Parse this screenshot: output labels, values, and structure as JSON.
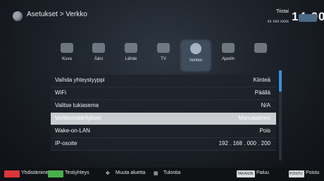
{
  "header": {
    "breadcrumb": "Asetukset > Verkko",
    "day": "Tiistai",
    "date": "xx xxx xxxx",
    "time": "14:00"
  },
  "tabs": [
    {
      "label": "Kuva",
      "icon": "picture-icon"
    },
    {
      "label": "Ääni",
      "icon": "sound-icon"
    },
    {
      "label": "Lähde",
      "icon": "source-icon"
    },
    {
      "label": "TV",
      "icon": "tv-icon"
    },
    {
      "label": "Verkko",
      "icon": "network-icon",
      "active": true
    },
    {
      "label": "Ajastin",
      "icon": "timer-icon"
    },
    {
      "label": "",
      "icon": "settings-icon"
    }
  ],
  "settings": [
    {
      "key": "Vaihda yhteystyyppi",
      "value": "Kiinteä"
    },
    {
      "key": "WiFi",
      "value": "Päällä"
    },
    {
      "key": "Valitse tukiasema",
      "value": "N/A"
    },
    {
      "key": "Verkkomääritykset",
      "value": "Manuaalinen",
      "selected": true
    },
    {
      "key": "Wake-on-LAN",
      "value": "Pois"
    },
    {
      "key": "IP-osoite",
      "value": "192 . 168 . 000 . 200"
    }
  ],
  "footer": {
    "connect": "Yhdistäminen",
    "test": "Testiyhteys",
    "move": "Muuta aluetta",
    "print": "Tulostia",
    "back_key": "TAKAISIN",
    "back": "Paluu",
    "exit_key": "POISTU",
    "exit": "Poistu"
  },
  "colors": {
    "accent": "#3d8fd6",
    "selected_row": "#c9ccd0",
    "red_key": "#d8363a",
    "green_key": "#4ab04a"
  }
}
